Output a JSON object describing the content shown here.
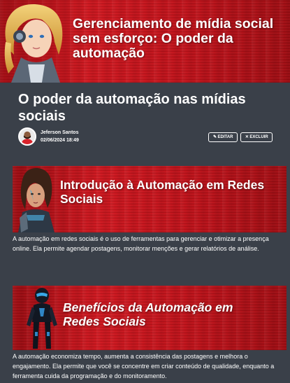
{
  "hero": {
    "title": "Gerenciamento de mídia social sem esforço: O poder da automação"
  },
  "post": {
    "title": "O poder da automação nas mídias sociais",
    "author": "Jeferson Santos",
    "date": "02/06/2024 18:49",
    "edit_label": "EDITAR",
    "delete_label": "EXCLUIR"
  },
  "sections": [
    {
      "banner_title": "Introdução à Automação em Redes Sociais",
      "text": "A automação em redes sociais é o uso de ferramentas para gerenciar e otimizar a presença online. Ela permite agendar postagens, monitorar menções e gerar relatórios de análise."
    },
    {
      "banner_title": "Benefícios da Automação em Redes Sociais",
      "text": "A automação economiza tempo, aumenta a consistência das postagens e melhora o engajamento. Ela permite que você se concentre em criar conteúdo de qualidade, enquanto a ferramenta cuida da programação e do monitoramento."
    }
  ],
  "colors": {
    "background": "#3a4049",
    "banner_red": "#c1121a",
    "text": "#ffffff"
  },
  "icons": {
    "edit": "pencil-icon",
    "delete": "x-icon"
  }
}
